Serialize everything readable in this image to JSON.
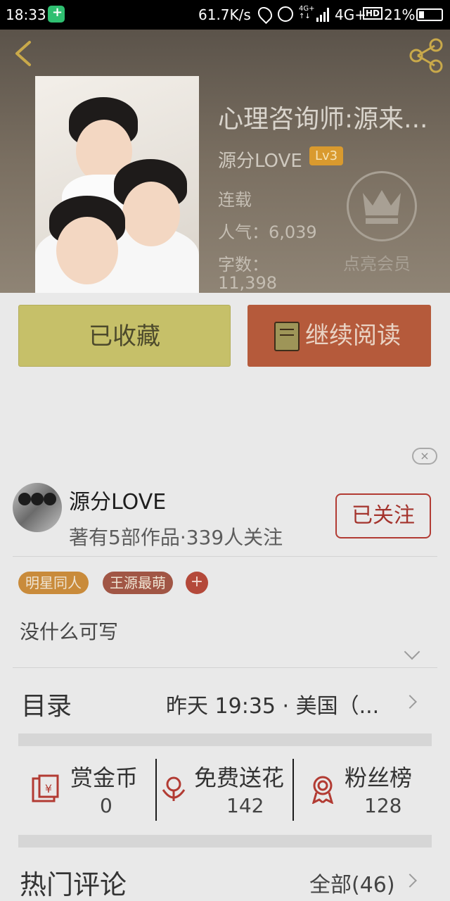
{
  "status_bar": {
    "time": "18:33",
    "speed": "61.7K/s",
    "net_small_top": "4G+",
    "net_small_bottom": "↑↓",
    "network": "4G+",
    "hd": "HD",
    "battery": "21%"
  },
  "book": {
    "title": "心理咨询师:源来...",
    "author": "源分LOVE",
    "level": "Lv3",
    "status": "连载",
    "popularity": "人气：6,039",
    "word_count_label": "字数：",
    "word_count": "11,398"
  },
  "membership": {
    "label": "点亮会员"
  },
  "actions": {
    "collected": "已收藏",
    "continue_reading": "继续阅读"
  },
  "author_card": {
    "name": "源分LOVE",
    "summary": "著有5部作品·339人关注",
    "follow_label": "已关注",
    "close_label": "×"
  },
  "tags": [
    "明星同人",
    "王源最萌"
  ],
  "tag_add": "+",
  "description": "没什么可写",
  "catalog": {
    "label": "目录",
    "info": "昨天 19:35 · 美国（..."
  },
  "stats": [
    {
      "label": "赏金币",
      "value": "0",
      "icon": "coin-envelope-icon"
    },
    {
      "label": "免费送花",
      "value": "142",
      "icon": "flower-icon"
    },
    {
      "label": "粉丝榜",
      "value": "128",
      "icon": "medal-icon"
    }
  ],
  "comments": {
    "label": "热门评论",
    "all": "全部(46)"
  },
  "colors": {
    "collect_button": "#c6c069",
    "read_button": "#b55a3b",
    "follow_border": "#b23b33",
    "level_badge": "#d99a2e"
  }
}
